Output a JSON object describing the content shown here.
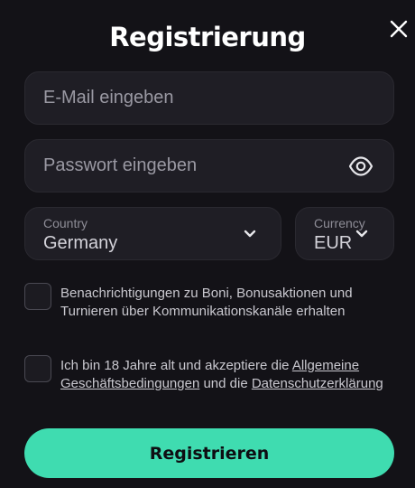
{
  "dialog": {
    "title": "Registrierung",
    "close_icon": "close-icon"
  },
  "form": {
    "email": {
      "placeholder": "E-Mail eingeben",
      "value": ""
    },
    "password": {
      "placeholder": "Passwort eingeben",
      "value": "",
      "toggle_icon": "eye-icon"
    },
    "country": {
      "label": "Country",
      "value": "Germany",
      "icon": "chevron-down-icon"
    },
    "currency": {
      "label": "Currency",
      "value": "EUR",
      "icon": "chevron-down-icon"
    },
    "consent_marketing": {
      "checked": false,
      "text": "Benachrichtigungen zu Boni, Bonusaktionen und Turnieren über Kommunikationskanäle erhalten"
    },
    "consent_terms": {
      "checked": false,
      "text_before": "Ich bin 18 Jahre alt und akzeptiere die ",
      "terms_link": "Allgemeine Geschäftsbedingungen",
      "text_middle": " und die ",
      "privacy_link": "Datenschutzerklärung"
    },
    "submit_label": "Registrieren"
  },
  "colors": {
    "background": "#131217",
    "field_background": "#1f1e25",
    "accent": "#3fdcb0",
    "text_primary": "#ffffff",
    "text_muted": "#9a99a3"
  }
}
